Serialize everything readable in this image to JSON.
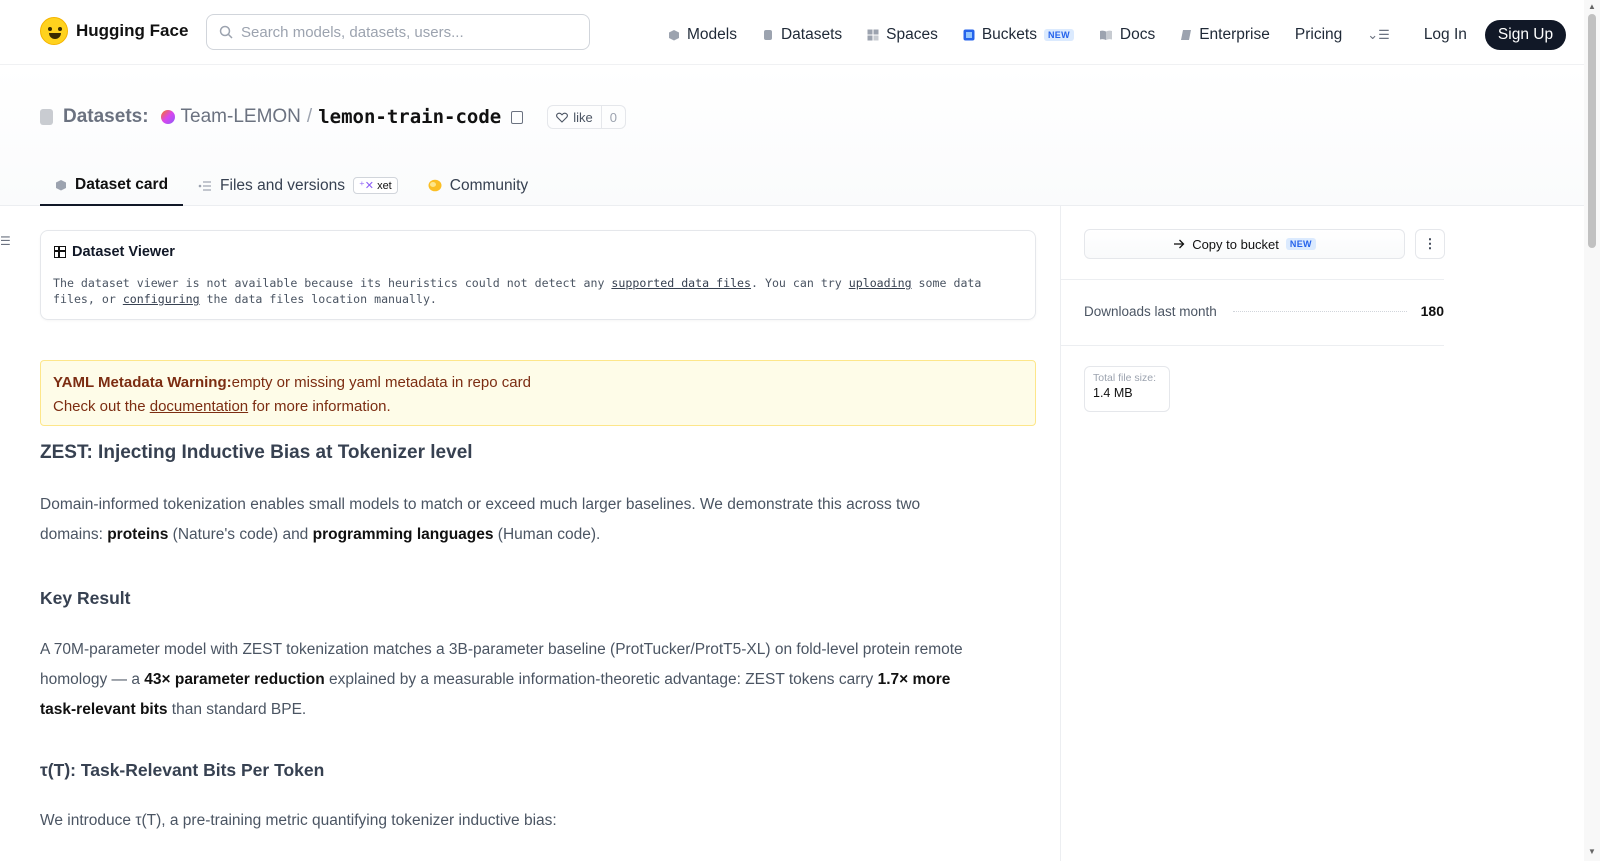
{
  "nav": {
    "brand": "Hugging Face",
    "search_placeholder": "Search models, datasets, users...",
    "links": [
      {
        "label": "Models",
        "icon": "cube-icon"
      },
      {
        "label": "Datasets",
        "icon": "database-icon"
      },
      {
        "label": "Spaces",
        "icon": "grid-icon"
      },
      {
        "label": "Buckets",
        "icon": "bucket-icon",
        "badge": "NEW"
      },
      {
        "label": "Docs",
        "icon": "book-icon"
      },
      {
        "label": "Enterprise",
        "icon": "enterprise-icon"
      },
      {
        "label": "Pricing"
      }
    ],
    "login": "Log In",
    "signup": "Sign Up"
  },
  "header": {
    "section_label": "Datasets:",
    "org": "Team-LEMON",
    "separator": "/",
    "repo": "lemon-train-code",
    "like_label": "like",
    "like_count": "0"
  },
  "tabs": [
    {
      "label": "Dataset card",
      "active": true
    },
    {
      "label": "Files and versions",
      "badge": "xet"
    },
    {
      "label": "Community"
    }
  ],
  "viewer": {
    "title": "Dataset Viewer",
    "msg_1": "The dataset viewer is not available because its heuristics could not detect any ",
    "link_1": "supported data files",
    "msg_2": ". You can try ",
    "link_2": "uploading",
    "msg_3": " some data files, or ",
    "link_3": "configuring",
    "msg_4": " the data files location manually."
  },
  "warning": {
    "bold": "YAML Metadata Warning:",
    "text": "empty or missing yaml metadata in repo card",
    "line2_pre": "Check out the ",
    "link": "documentation",
    "line2_post": " for more information."
  },
  "card": {
    "h1": "ZEST: Injecting Inductive Bias at Tokenizer level",
    "p1_a": "Domain-informed tokenization enables small models to match or exceed much larger baselines. We demonstrate this across two domains: ",
    "p1_b": "proteins",
    "p1_c": " (Nature's code) and ",
    "p1_d": "programming languages",
    "p1_e": " (Human code).",
    "h2": "Key Result",
    "p2_a": "A 70M-parameter model with ZEST tokenization matches a 3B-parameter baseline (ProtTucker/ProtT5-XL) on fold-level protein remote homology — a ",
    "p2_b": "43× parameter reduction",
    "p2_c": " explained by a measurable information-theoretic advantage: ZEST tokens carry ",
    "p2_d": "1.7× more task-relevant bits",
    "p2_e": " than standard BPE.",
    "h3": "τ(T): Task-Relevant Bits Per Token",
    "p3": "We introduce τ(T), a pre-training metric quantifying tokenizer inductive bias:"
  },
  "sidebar": {
    "copy_bucket": "Copy to bucket",
    "copy_badge": "NEW",
    "downloads_label": "Downloads last month",
    "downloads_value": "180",
    "filesize_label": "Total file size:",
    "filesize_value": "1.4 MB"
  },
  "colors": {
    "brand_yellow": "#FFD21E",
    "signup_bg": "#111827",
    "warning_bg": "#fefce8",
    "new_badge": "#2563eb"
  }
}
